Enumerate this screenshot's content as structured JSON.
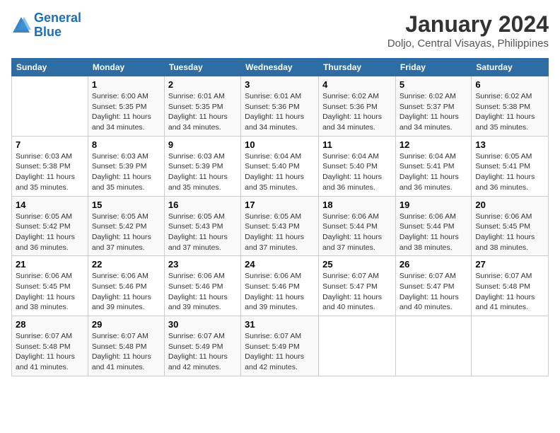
{
  "logo": {
    "line1": "General",
    "line2": "Blue"
  },
  "title": "January 2024",
  "subtitle": "Doljo, Central Visayas, Philippines",
  "days_of_week": [
    "Sunday",
    "Monday",
    "Tuesday",
    "Wednesday",
    "Thursday",
    "Friday",
    "Saturday"
  ],
  "weeks": [
    [
      {
        "day": "",
        "sunrise": "",
        "sunset": "",
        "daylight": ""
      },
      {
        "day": "1",
        "sunrise": "Sunrise: 6:00 AM",
        "sunset": "Sunset: 5:35 PM",
        "daylight": "Daylight: 11 hours and 34 minutes."
      },
      {
        "day": "2",
        "sunrise": "Sunrise: 6:01 AM",
        "sunset": "Sunset: 5:35 PM",
        "daylight": "Daylight: 11 hours and 34 minutes."
      },
      {
        "day": "3",
        "sunrise": "Sunrise: 6:01 AM",
        "sunset": "Sunset: 5:36 PM",
        "daylight": "Daylight: 11 hours and 34 minutes."
      },
      {
        "day": "4",
        "sunrise": "Sunrise: 6:02 AM",
        "sunset": "Sunset: 5:36 PM",
        "daylight": "Daylight: 11 hours and 34 minutes."
      },
      {
        "day": "5",
        "sunrise": "Sunrise: 6:02 AM",
        "sunset": "Sunset: 5:37 PM",
        "daylight": "Daylight: 11 hours and 34 minutes."
      },
      {
        "day": "6",
        "sunrise": "Sunrise: 6:02 AM",
        "sunset": "Sunset: 5:38 PM",
        "daylight": "Daylight: 11 hours and 35 minutes."
      }
    ],
    [
      {
        "day": "7",
        "sunrise": "Sunrise: 6:03 AM",
        "sunset": "Sunset: 5:38 PM",
        "daylight": "Daylight: 11 hours and 35 minutes."
      },
      {
        "day": "8",
        "sunrise": "Sunrise: 6:03 AM",
        "sunset": "Sunset: 5:39 PM",
        "daylight": "Daylight: 11 hours and 35 minutes."
      },
      {
        "day": "9",
        "sunrise": "Sunrise: 6:03 AM",
        "sunset": "Sunset: 5:39 PM",
        "daylight": "Daylight: 11 hours and 35 minutes."
      },
      {
        "day": "10",
        "sunrise": "Sunrise: 6:04 AM",
        "sunset": "Sunset: 5:40 PM",
        "daylight": "Daylight: 11 hours and 35 minutes."
      },
      {
        "day": "11",
        "sunrise": "Sunrise: 6:04 AM",
        "sunset": "Sunset: 5:40 PM",
        "daylight": "Daylight: 11 hours and 36 minutes."
      },
      {
        "day": "12",
        "sunrise": "Sunrise: 6:04 AM",
        "sunset": "Sunset: 5:41 PM",
        "daylight": "Daylight: 11 hours and 36 minutes."
      },
      {
        "day": "13",
        "sunrise": "Sunrise: 6:05 AM",
        "sunset": "Sunset: 5:41 PM",
        "daylight": "Daylight: 11 hours and 36 minutes."
      }
    ],
    [
      {
        "day": "14",
        "sunrise": "Sunrise: 6:05 AM",
        "sunset": "Sunset: 5:42 PM",
        "daylight": "Daylight: 11 hours and 36 minutes."
      },
      {
        "day": "15",
        "sunrise": "Sunrise: 6:05 AM",
        "sunset": "Sunset: 5:42 PM",
        "daylight": "Daylight: 11 hours and 37 minutes."
      },
      {
        "day": "16",
        "sunrise": "Sunrise: 6:05 AM",
        "sunset": "Sunset: 5:43 PM",
        "daylight": "Daylight: 11 hours and 37 minutes."
      },
      {
        "day": "17",
        "sunrise": "Sunrise: 6:05 AM",
        "sunset": "Sunset: 5:43 PM",
        "daylight": "Daylight: 11 hours and 37 minutes."
      },
      {
        "day": "18",
        "sunrise": "Sunrise: 6:06 AM",
        "sunset": "Sunset: 5:44 PM",
        "daylight": "Daylight: 11 hours and 37 minutes."
      },
      {
        "day": "19",
        "sunrise": "Sunrise: 6:06 AM",
        "sunset": "Sunset: 5:44 PM",
        "daylight": "Daylight: 11 hours and 38 minutes."
      },
      {
        "day": "20",
        "sunrise": "Sunrise: 6:06 AM",
        "sunset": "Sunset: 5:45 PM",
        "daylight": "Daylight: 11 hours and 38 minutes."
      }
    ],
    [
      {
        "day": "21",
        "sunrise": "Sunrise: 6:06 AM",
        "sunset": "Sunset: 5:45 PM",
        "daylight": "Daylight: 11 hours and 38 minutes."
      },
      {
        "day": "22",
        "sunrise": "Sunrise: 6:06 AM",
        "sunset": "Sunset: 5:46 PM",
        "daylight": "Daylight: 11 hours and 39 minutes."
      },
      {
        "day": "23",
        "sunrise": "Sunrise: 6:06 AM",
        "sunset": "Sunset: 5:46 PM",
        "daylight": "Daylight: 11 hours and 39 minutes."
      },
      {
        "day": "24",
        "sunrise": "Sunrise: 6:06 AM",
        "sunset": "Sunset: 5:46 PM",
        "daylight": "Daylight: 11 hours and 39 minutes."
      },
      {
        "day": "25",
        "sunrise": "Sunrise: 6:07 AM",
        "sunset": "Sunset: 5:47 PM",
        "daylight": "Daylight: 11 hours and 40 minutes."
      },
      {
        "day": "26",
        "sunrise": "Sunrise: 6:07 AM",
        "sunset": "Sunset: 5:47 PM",
        "daylight": "Daylight: 11 hours and 40 minutes."
      },
      {
        "day": "27",
        "sunrise": "Sunrise: 6:07 AM",
        "sunset": "Sunset: 5:48 PM",
        "daylight": "Daylight: 11 hours and 41 minutes."
      }
    ],
    [
      {
        "day": "28",
        "sunrise": "Sunrise: 6:07 AM",
        "sunset": "Sunset: 5:48 PM",
        "daylight": "Daylight: 11 hours and 41 minutes."
      },
      {
        "day": "29",
        "sunrise": "Sunrise: 6:07 AM",
        "sunset": "Sunset: 5:48 PM",
        "daylight": "Daylight: 11 hours and 41 minutes."
      },
      {
        "day": "30",
        "sunrise": "Sunrise: 6:07 AM",
        "sunset": "Sunset: 5:49 PM",
        "daylight": "Daylight: 11 hours and 42 minutes."
      },
      {
        "day": "31",
        "sunrise": "Sunrise: 6:07 AM",
        "sunset": "Sunset: 5:49 PM",
        "daylight": "Daylight: 11 hours and 42 minutes."
      },
      {
        "day": "",
        "sunrise": "",
        "sunset": "",
        "daylight": ""
      },
      {
        "day": "",
        "sunrise": "",
        "sunset": "",
        "daylight": ""
      },
      {
        "day": "",
        "sunrise": "",
        "sunset": "",
        "daylight": ""
      }
    ]
  ]
}
